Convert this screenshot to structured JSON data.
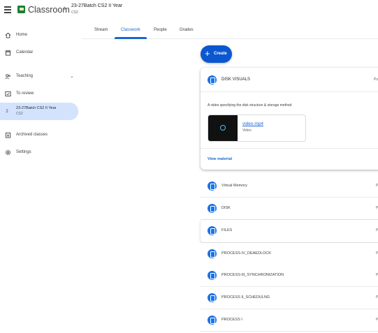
{
  "header": {
    "app_title": "Classroom",
    "class_name": "23-27Batch CS2 II Year",
    "class_section": "CS2"
  },
  "sidebar": {
    "items": [
      {
        "label": "Home",
        "icon": "home-icon"
      },
      {
        "label": "Calendar",
        "icon": "calendar-icon"
      },
      {
        "label": "Teaching",
        "icon": "people-icon"
      },
      {
        "label": "To review",
        "icon": "review-icon"
      },
      {
        "label": "Archived classes",
        "icon": "archive-icon"
      },
      {
        "label": "Settings",
        "icon": "gear-icon"
      }
    ],
    "selected_class": {
      "avatar": "2",
      "title": "23-27Batch CS2 II Year",
      "subtitle": "CS2"
    }
  },
  "tabs": [
    "Stream",
    "Classwork",
    "People",
    "Grades"
  ],
  "active_tab": "Classwork",
  "create_label": "Create",
  "expanded": {
    "title": "DISK VISUALS",
    "posted": "Po",
    "description": "A video specifying the disk structure & storage method",
    "attachment": {
      "name": "video.mp4",
      "type": "Video"
    },
    "view_label": "View material"
  },
  "materials": [
    {
      "title": "Virtual Memory",
      "date": "P"
    },
    {
      "title": "DISK",
      "date": "P"
    },
    {
      "title": "FILES",
      "date": "P"
    },
    {
      "title": "PROCESS-IV_DEAEDLOCK",
      "date": "P"
    },
    {
      "title": "PROCESS-III_SYNCHRONIZATION",
      "date": "P"
    },
    {
      "title": "PROCESS II_SCHEDULNG",
      "date": "P"
    },
    {
      "title": "PROCESS I",
      "date": "P"
    }
  ],
  "colors": {
    "accent": "#1967d2",
    "create": "#0b57d0",
    "selected_bg": "#d3e3fd",
    "logo": "#188038"
  }
}
